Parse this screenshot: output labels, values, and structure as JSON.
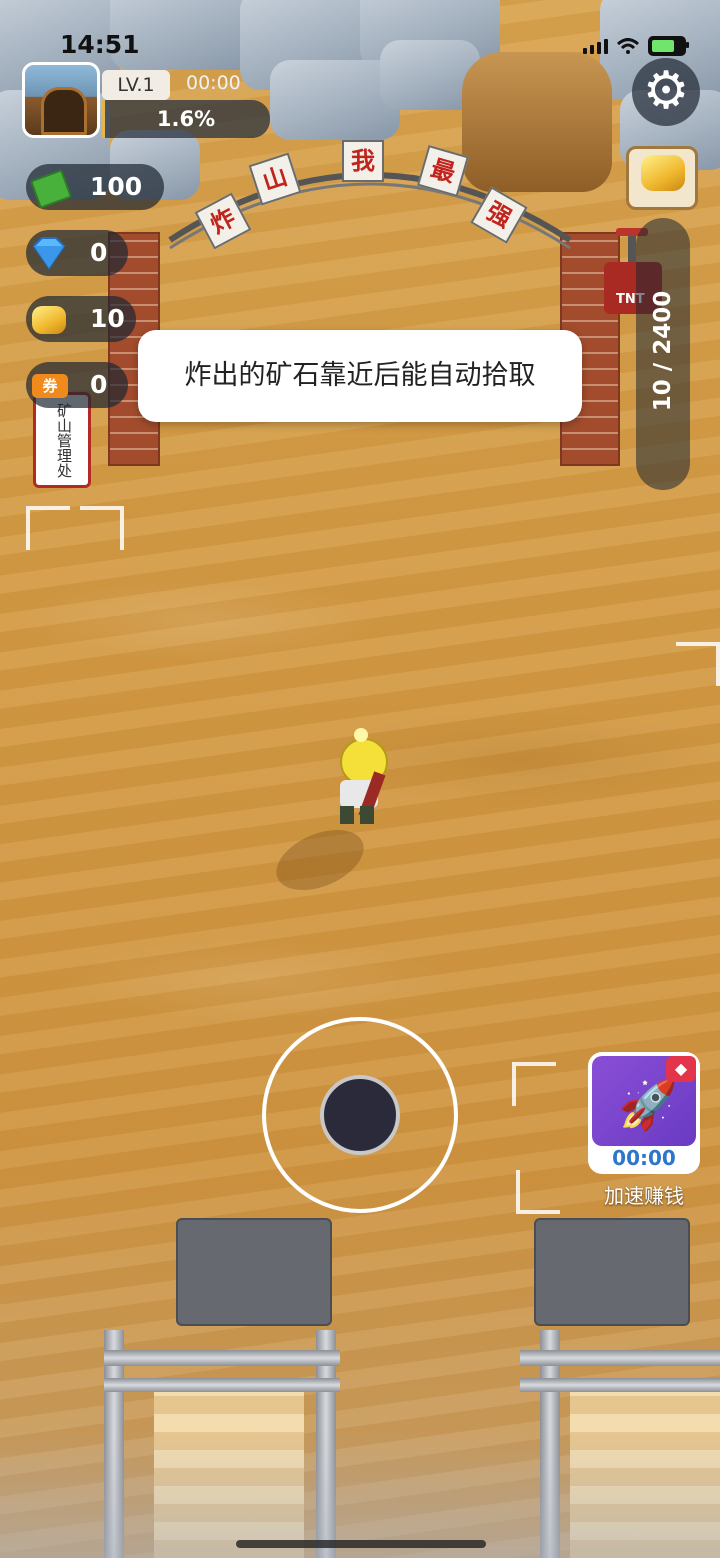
{
  "status_bar": {
    "time": "14:51"
  },
  "player": {
    "level": "LV.1",
    "timer": "00:00",
    "progress_text": "1.6%",
    "progress": 0.016
  },
  "resources": [
    {
      "name": "cash",
      "icon": "cash-icon",
      "value": "100"
    },
    {
      "name": "diamond",
      "icon": "diamond-icon",
      "value": "0"
    },
    {
      "name": "gold",
      "icon": "gold-nugget-icon",
      "value": "10"
    },
    {
      "name": "ticket",
      "icon": "ticket-icon",
      "value": "0"
    }
  ],
  "ticket_icon_text": "券",
  "arch_sign": [
    "炸",
    "山",
    "我",
    "最",
    "强"
  ],
  "banner_text": "矿山管理处",
  "tnt_label": "TNT",
  "capacity": {
    "text": "10 / 2400",
    "current": 10,
    "max": 2400
  },
  "tip": "炸出的矿石靠近后能自动拾取",
  "boost": {
    "timer": "00:00",
    "label": "加速赚钱"
  },
  "colors": {
    "sand": "#d39a44",
    "progress_fill": "#e7b64a",
    "hud_bg": "#1e2632",
    "boost_bg": "#7a45cf"
  }
}
